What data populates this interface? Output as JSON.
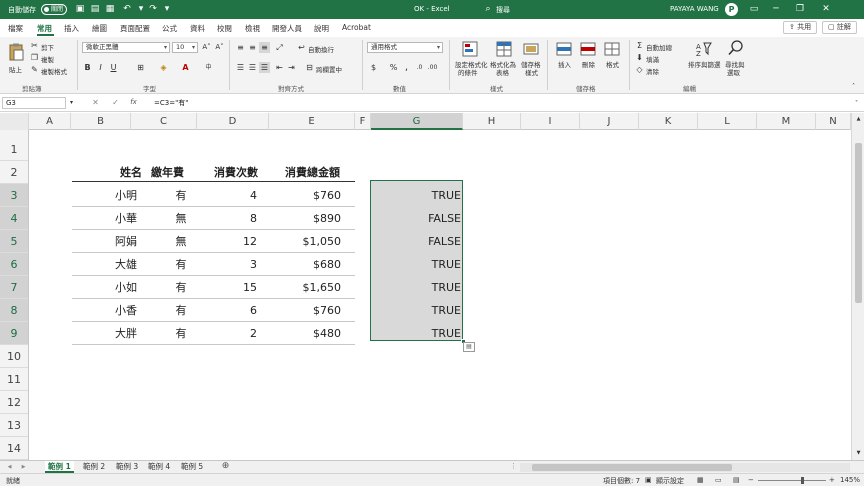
{
  "titlebar": {
    "autosave_label": "自動儲存",
    "autosave_state": "關閉",
    "doc_title": "OK  -  Excel",
    "search_label": "搜尋",
    "user_name": "PAYAYA WANG",
    "avatar_letter": "P",
    "color": "#217346"
  },
  "tabs": {
    "items": [
      "檔案",
      "常用",
      "插入",
      "繪圖",
      "頁面配置",
      "公式",
      "資料",
      "校閱",
      "檢視",
      "開發人員",
      "說明",
      "Acrobat"
    ],
    "active": "常用",
    "share": "共用",
    "comment": "註解"
  },
  "ribbon": {
    "paste": "貼上",
    "cut": "剪下",
    "copy": "複製",
    "format_painter": "複製格式",
    "clipboard_group": "剪貼簿",
    "font_name": "微軟正黑體",
    "font_size": "10",
    "font_group": "字型",
    "wrap_text": "自動換行",
    "merge_center": "跨欄置中",
    "alignment_group": "對齊方式",
    "number_format": "通用格式",
    "number_group": "數值",
    "conditional_formatting": [
      "設定格式化",
      "的條件"
    ],
    "format_as_table": [
      "格式化為",
      "表格"
    ],
    "cell_styles": [
      "儲存格",
      "樣式"
    ],
    "styles_group": "樣式",
    "insert": "插入",
    "delete": "刪除",
    "format": "格式",
    "cells_group": "儲存格",
    "autosum": "自動加總",
    "fill": "填滿",
    "clear": "清除",
    "sort_filter": [
      "排序與篩選"
    ],
    "find_select": [
      "尋找與",
      "選取"
    ],
    "editing_group": "編輯"
  },
  "formula_bar": {
    "name_box": "G3",
    "formula": "=C3=\"有\""
  },
  "grid": {
    "columns": [
      "A",
      "B",
      "C",
      "D",
      "E",
      "F",
      "G",
      "H",
      "I",
      "J",
      "K",
      "L",
      "M",
      "N"
    ],
    "rows": [
      "1",
      "2",
      "3",
      "4",
      "5",
      "6",
      "7",
      "8",
      "9",
      "10",
      "11",
      "12",
      "13",
      "14"
    ],
    "selected_column": "G",
    "table_headers": [
      "姓名",
      "繳年費",
      "消費次數",
      "消費總金額"
    ],
    "table_rows": [
      {
        "name": "小明",
        "fee": "有",
        "count": "4",
        "amount": "$760",
        "result": "TRUE"
      },
      {
        "name": "小華",
        "fee": "無",
        "count": "8",
        "amount": "$890",
        "result": "FALSE"
      },
      {
        "name": "阿娟",
        "fee": "無",
        "count": "12",
        "amount": "$1,050",
        "result": "FALSE"
      },
      {
        "name": "大雄",
        "fee": "有",
        "count": "3",
        "amount": "$680",
        "result": "TRUE"
      },
      {
        "name": "小如",
        "fee": "有",
        "count": "15",
        "amount": "$1,650",
        "result": "TRUE"
      },
      {
        "name": "小香",
        "fee": "有",
        "count": "6",
        "amount": "$760",
        "result": "TRUE"
      },
      {
        "name": "大胖",
        "fee": "有",
        "count": "2",
        "amount": "$480",
        "result": "TRUE"
      }
    ]
  },
  "sheets": {
    "items": [
      "範例 1",
      "範例 2",
      "範例 3",
      "範例 4",
      "範例 5"
    ],
    "active": "範例 1"
  },
  "statusbar": {
    "ready": "就緒",
    "count_label": "項目個數: 7",
    "display_settings": "顯示設定",
    "zoom": "145%"
  }
}
